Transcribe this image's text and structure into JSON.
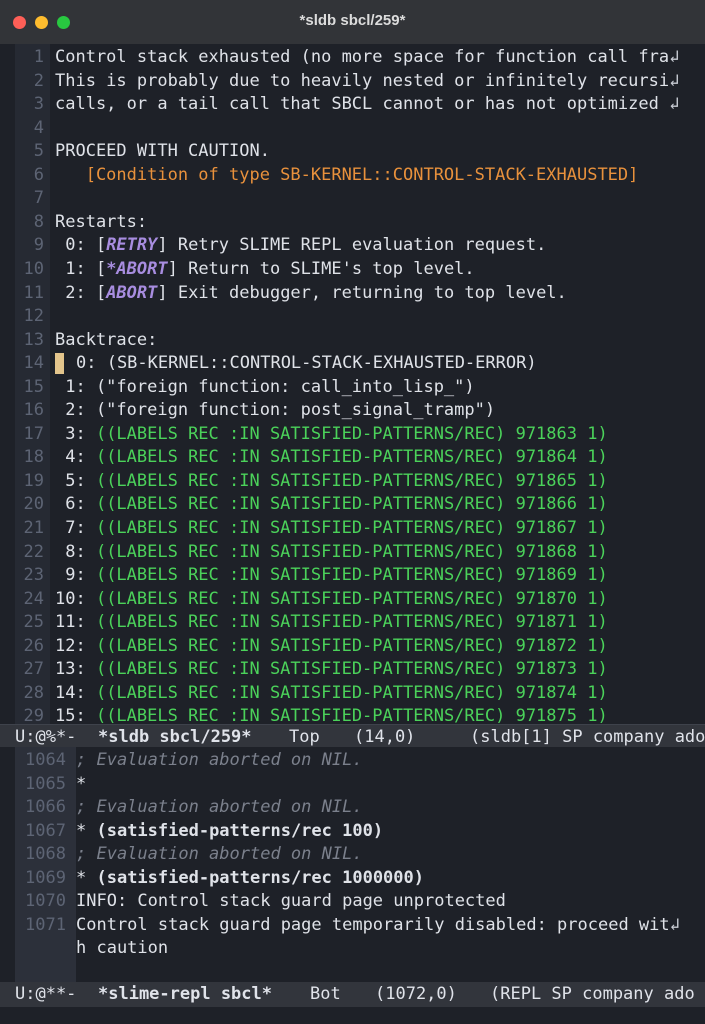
{
  "window": {
    "title": "*sldb sbcl/259*"
  },
  "sldb": {
    "lines": [
      {
        "n": "1",
        "text": "Control stack exhausted (no more space for function call fra",
        "cont": "↲"
      },
      {
        "n": "2",
        "text": "This is probably due to heavily nested or infinitely recursi",
        "cont": "↲"
      },
      {
        "n": "3",
        "text": "calls, or a tail call that SBCL cannot or has not optimized ",
        "cont": "↲"
      },
      {
        "n": "4",
        "text": ""
      },
      {
        "n": "5",
        "text": "PROCEED WITH CAUTION."
      },
      {
        "n": "6",
        "text": "   [Condition of type SB-KERNEL::CONTROL-STACK-EXHAUSTED]",
        "style": "orange"
      },
      {
        "n": "7",
        "text": ""
      },
      {
        "n": "8",
        "text": "Restarts:"
      },
      {
        "n": "9",
        "pre": " 0: [",
        "tag": "RETRY",
        "post": "] Retry SLIME REPL evaluation request."
      },
      {
        "n": "10",
        "pre": " 1: [",
        "tag": "*ABORT",
        "post": "] Return to SLIME's top level."
      },
      {
        "n": "11",
        "pre": " 2: [",
        "tag": "ABORT",
        "post": "] Exit debugger, returning to top level."
      },
      {
        "n": "12",
        "text": ""
      },
      {
        "n": "13",
        "text": "Backtrace:"
      },
      {
        "n": "14",
        "text": "0: (SB-KERNEL::CONTROL-STACK-EXHAUSTED-ERROR)",
        "cursor": true
      },
      {
        "n": "15",
        "text": " 1: (\"foreign function: call_into_lisp_\")"
      },
      {
        "n": "16",
        "text": " 2: (\"foreign function: post_signal_tramp\")"
      },
      {
        "n": "17",
        "pre": " 3: ",
        "text": "((LABELS REC :IN SATISFIED-PATTERNS/REC) 971863 1)",
        "style": "green"
      },
      {
        "n": "18",
        "pre": " 4: ",
        "text": "((LABELS REC :IN SATISFIED-PATTERNS/REC) 971864 1)",
        "style": "green"
      },
      {
        "n": "19",
        "pre": " 5: ",
        "text": "((LABELS REC :IN SATISFIED-PATTERNS/REC) 971865 1)",
        "style": "green"
      },
      {
        "n": "20",
        "pre": " 6: ",
        "text": "((LABELS REC :IN SATISFIED-PATTERNS/REC) 971866 1)",
        "style": "green"
      },
      {
        "n": "21",
        "pre": " 7: ",
        "text": "((LABELS REC :IN SATISFIED-PATTERNS/REC) 971867 1)",
        "style": "green"
      },
      {
        "n": "22",
        "pre": " 8: ",
        "text": "((LABELS REC :IN SATISFIED-PATTERNS/REC) 971868 1)",
        "style": "green"
      },
      {
        "n": "23",
        "pre": " 9: ",
        "text": "((LABELS REC :IN SATISFIED-PATTERNS/REC) 971869 1)",
        "style": "green"
      },
      {
        "n": "24",
        "pre": "10: ",
        "text": "((LABELS REC :IN SATISFIED-PATTERNS/REC) 971870 1)",
        "style": "green"
      },
      {
        "n": "25",
        "pre": "11: ",
        "text": "((LABELS REC :IN SATISFIED-PATTERNS/REC) 971871 1)",
        "style": "green"
      },
      {
        "n": "26",
        "pre": "12: ",
        "text": "((LABELS REC :IN SATISFIED-PATTERNS/REC) 971872 1)",
        "style": "green"
      },
      {
        "n": "27",
        "pre": "13: ",
        "text": "((LABELS REC :IN SATISFIED-PATTERNS/REC) 971873 1)",
        "style": "green"
      },
      {
        "n": "28",
        "pre": "14: ",
        "text": "((LABELS REC :IN SATISFIED-PATTERNS/REC) 971874 1)",
        "style": "green"
      },
      {
        "n": "29",
        "pre": "15: ",
        "text": "((LABELS REC :IN SATISFIED-PATTERNS/REC) 971875 1)",
        "style": "green"
      }
    ]
  },
  "modeline_sldb": {
    "status": "U:@%*-",
    "buffer": "*sldb sbcl/259*",
    "position": "Top",
    "coords": "(14,0)",
    "modes": "(sldb[1] SP company ado"
  },
  "repl": {
    "lines": [
      {
        "n": "1064",
        "text": "; Evaluation aborted on NIL.",
        "style": "comment"
      },
      {
        "n": "1065",
        "text": "*"
      },
      {
        "n": "1066",
        "text": "; Evaluation aborted on NIL.",
        "style": "comment"
      },
      {
        "n": "1067",
        "pre": "* ",
        "text": "(satisfied-patterns/rec 100)",
        "style": "bold"
      },
      {
        "n": "1068",
        "text": "; Evaluation aborted on NIL.",
        "style": "comment"
      },
      {
        "n": "1069",
        "pre": "* ",
        "text": "(satisfied-patterns/rec 1000000)",
        "style": "bold"
      },
      {
        "n": "1070",
        "text": "INFO: Control stack guard page unprotected"
      },
      {
        "n": "1071",
        "text": "Control stack guard page temporarily disabled: proceed wit",
        "cont": "↲"
      },
      {
        "n": "",
        "text": "h caution"
      }
    ]
  },
  "modeline_repl": {
    "status": "U:@**-",
    "buffer": "*slime-repl sbcl*",
    "position": "Bot",
    "coords": "(1072,0)",
    "modes": "(REPL SP company ado"
  }
}
